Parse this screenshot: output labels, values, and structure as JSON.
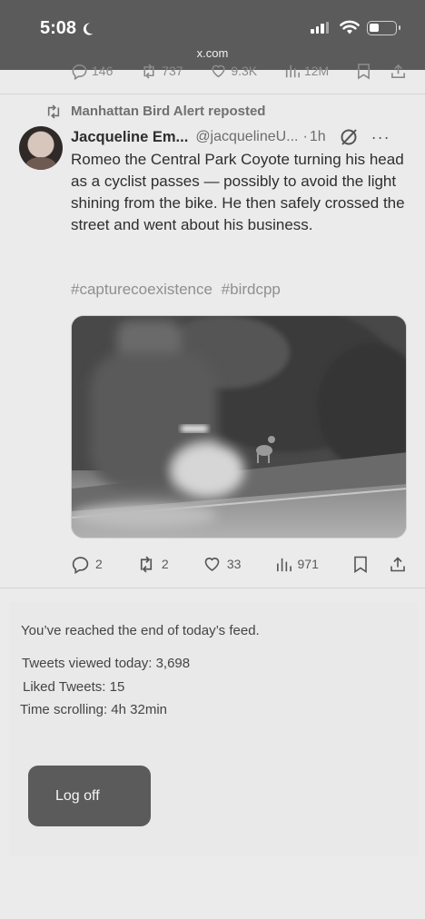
{
  "status_bar": {
    "time": "5:08",
    "url": "x.com"
  },
  "previous_tweet_actions": {
    "replies": "146",
    "reposts": "737",
    "likes": "9.3K",
    "views": "12M"
  },
  "tweet": {
    "repost_label": "Manhattan Bird Alert reposted",
    "author_name": "Jacqueline Em...",
    "author_handle": "@jacquelineU...",
    "separator": "·",
    "time_ago": "1h",
    "more": "···",
    "text": "Romeo the Central Park Coyote turning his head as a cyclist passes — possibly to avoid the light shining from the bike. He then safely crossed the street and went about his business.",
    "hashtags": [
      "#capturecoexistence",
      "#birdcpp"
    ],
    "replies": "2",
    "reposts": "2",
    "likes": "33",
    "views": "971"
  },
  "end_feed": {
    "message": "You’ve reached the end of today’s feed.",
    "tweets_viewed": "Tweets viewed today: 3,698",
    "liked_tweets": "Liked Tweets: 15",
    "time_scrolling": "Time scrolling: 4h 32min",
    "logoff_label": "Log off"
  },
  "colors": {
    "status_bar_bg": "#5b5b5b",
    "page_bg": "#ebebeb",
    "button_bg": "#5b5b5b"
  }
}
